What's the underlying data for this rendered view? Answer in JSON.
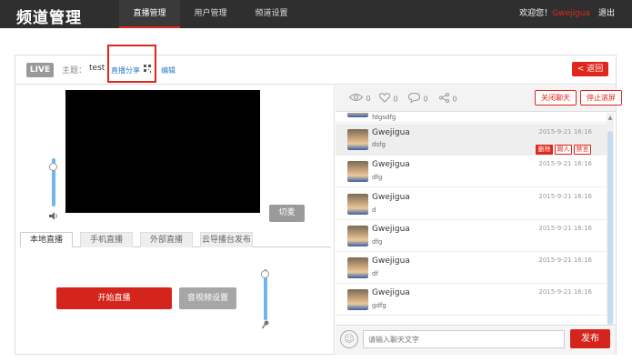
{
  "nav": {
    "logo": "频道管理",
    "tabs": [
      "直播管理",
      "用户管理",
      "频道设置"
    ],
    "welcome": "欢迎您！",
    "username": "Gwejigua",
    "logout": "退出"
  },
  "header": {
    "live": "LIVE",
    "topic_label": "主题：",
    "topic_value": "test",
    "share": "直播分享",
    "edit": "编辑",
    "back": "< 返回"
  },
  "player": {
    "switch_label": "切麦",
    "tabs": [
      "本地直播",
      "手机直播",
      "外部直播",
      "云导播台发布"
    ],
    "start_label": "开始直播",
    "av_settings_label": "音视频设置"
  },
  "chat": {
    "stats": {
      "views": "0",
      "likes": "0",
      "comments": "0",
      "shares": "0"
    },
    "close_chat": "关闭聊天",
    "stop_scroll": "停止滚屏",
    "top_partial_text": "fdgsdfg",
    "messages": [
      {
        "name": "Gwejigua",
        "text": "dsfg",
        "time": "2015-9-21 16:16",
        "actions": [
          "删除",
          "踢人",
          "禁言"
        ]
      },
      {
        "name": "Gwejigua",
        "text": "dfg",
        "time": "2015-9-21 16:16"
      },
      {
        "name": "Gwejigua",
        "text": "d",
        "time": "2015-9-21 16:16"
      },
      {
        "name": "Gwejigua",
        "text": "dfg",
        "time": "2015-9-21 16:16"
      },
      {
        "name": "Gwejigua",
        "text": "df",
        "time": "2015-9-21 16:16"
      },
      {
        "name": "Gwejigua",
        "text": "gdfg",
        "time": "2015-9-21 16:16"
      }
    ],
    "input_placeholder": "请输入聊天文字",
    "send": "发布"
  },
  "colors": {
    "accent": "#e0271b",
    "topbar": "#2f2f2f",
    "link": "#2a7fc6"
  }
}
